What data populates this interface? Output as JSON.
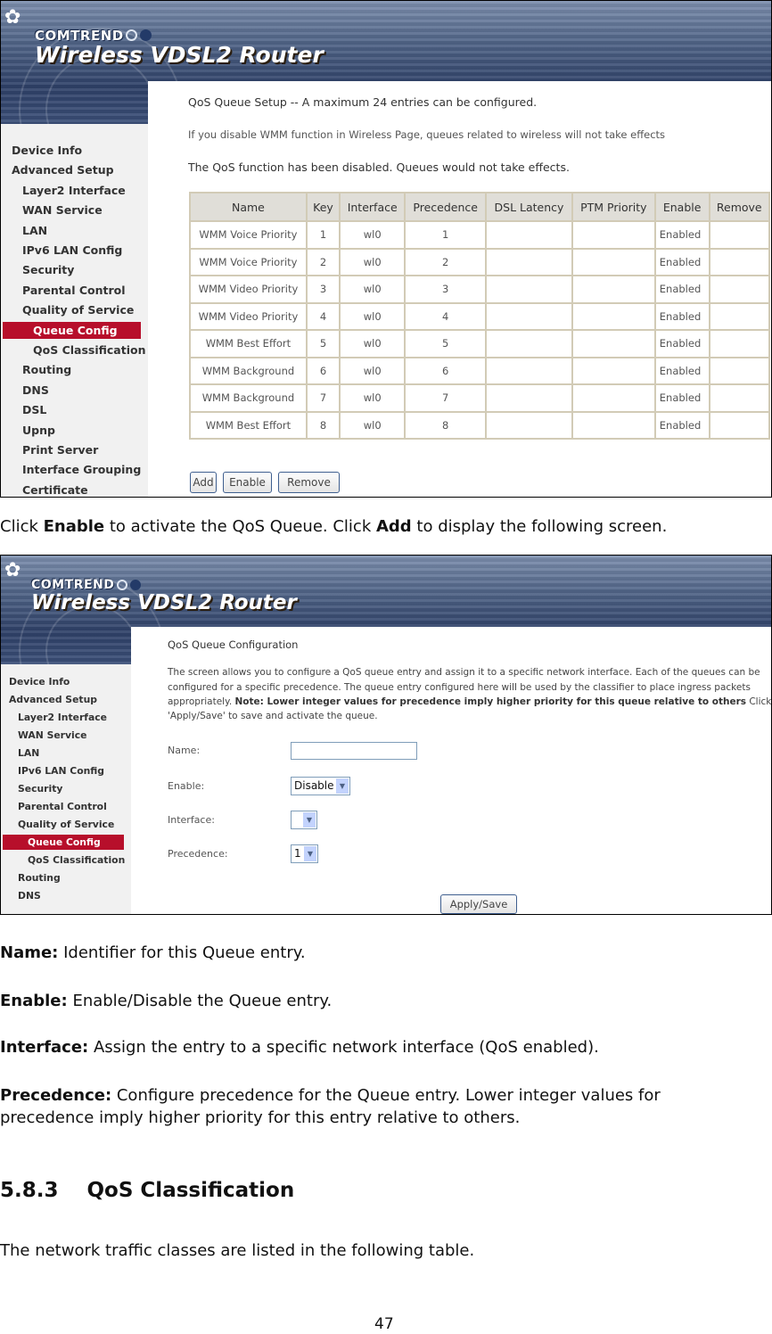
{
  "brand": {
    "company": "COMTREND",
    "product": "Wireless VDSL2 Router"
  },
  "screenshot1": {
    "sidebar": [
      {
        "label": "Device Info",
        "level": 0,
        "active": false
      },
      {
        "label": "Advanced Setup",
        "level": 0,
        "active": false
      },
      {
        "label": "Layer2 Interface",
        "level": 1,
        "active": false
      },
      {
        "label": "WAN Service",
        "level": 1,
        "active": false
      },
      {
        "label": "LAN",
        "level": 1,
        "active": false
      },
      {
        "label": "IPv6 LAN Config",
        "level": 1,
        "active": false
      },
      {
        "label": "Security",
        "level": 1,
        "active": false
      },
      {
        "label": "Parental Control",
        "level": 1,
        "active": false
      },
      {
        "label": "Quality of Service",
        "level": 1,
        "active": false
      },
      {
        "label": "Queue Config",
        "level": 2,
        "active": true
      },
      {
        "label": "QoS Classification",
        "level": 2,
        "active": false
      },
      {
        "label": "Routing",
        "level": 1,
        "active": false
      },
      {
        "label": "DNS",
        "level": 1,
        "active": false
      },
      {
        "label": "DSL",
        "level": 1,
        "active": false
      },
      {
        "label": "Upnp",
        "level": 1,
        "active": false
      },
      {
        "label": "Print Server",
        "level": 1,
        "active": false
      },
      {
        "label": "Interface Grouping",
        "level": 1,
        "active": false
      },
      {
        "label": "Certificate",
        "level": 1,
        "active": false
      }
    ],
    "title": "QoS Queue Setup -- A maximum 24 entries can be configured.",
    "wmm_note": "If you disable WMM function in Wireless Page, queues related to wireless will not take effects",
    "disabled_note": "The QoS function has been disabled. Queues would not take effects.",
    "table": {
      "headers": [
        "Name",
        "Key",
        "Interface",
        "Precedence",
        "DSL Latency",
        "PTM Priority",
        "Enable",
        "Remove"
      ],
      "rows": [
        [
          "WMM Voice Priority",
          "1",
          "wl0",
          "1",
          "",
          "",
          "Enabled",
          ""
        ],
        [
          "WMM Voice Priority",
          "2",
          "wl0",
          "2",
          "",
          "",
          "Enabled",
          ""
        ],
        [
          "WMM Video Priority",
          "3",
          "wl0",
          "3",
          "",
          "",
          "Enabled",
          ""
        ],
        [
          "WMM Video Priority",
          "4",
          "wl0",
          "4",
          "",
          "",
          "Enabled",
          ""
        ],
        [
          "WMM Best Effort",
          "5",
          "wl0",
          "5",
          "",
          "",
          "Enabled",
          ""
        ],
        [
          "WMM Background",
          "6",
          "wl0",
          "6",
          "",
          "",
          "Enabled",
          ""
        ],
        [
          "WMM Background",
          "7",
          "wl0",
          "7",
          "",
          "",
          "Enabled",
          ""
        ],
        [
          "WMM Best Effort",
          "8",
          "wl0",
          "8",
          "",
          "",
          "Enabled",
          ""
        ]
      ]
    },
    "buttons": {
      "add": "Add",
      "enable": "Enable",
      "remove": "Remove"
    }
  },
  "caption1": {
    "pre": "Click ",
    "b1": "Enable",
    "mid": " to activate the QoS Queue. Click ",
    "b2": "Add",
    "post": " to display the following screen."
  },
  "screenshot2": {
    "sidebar": [
      {
        "label": "Device Info",
        "level": 0,
        "active": false
      },
      {
        "label": "Advanced Setup",
        "level": 0,
        "active": false
      },
      {
        "label": "Layer2 Interface",
        "level": 1,
        "active": false
      },
      {
        "label": "WAN Service",
        "level": 1,
        "active": false
      },
      {
        "label": "LAN",
        "level": 1,
        "active": false
      },
      {
        "label": "IPv6 LAN Config",
        "level": 1,
        "active": false
      },
      {
        "label": "Security",
        "level": 1,
        "active": false
      },
      {
        "label": "Parental Control",
        "level": 1,
        "active": false
      },
      {
        "label": "Quality of Service",
        "level": 1,
        "active": false
      },
      {
        "label": "Queue Config",
        "level": 2,
        "active": true
      },
      {
        "label": "QoS Classification",
        "level": 2,
        "active": false
      },
      {
        "label": "Routing",
        "level": 1,
        "active": false
      },
      {
        "label": "DNS",
        "level": 1,
        "active": false
      }
    ],
    "title": "QoS Queue Configuration",
    "desc_line1": "The screen allows you to configure a QoS queue entry and assign it to a specific network interface. Each of the queues can be",
    "desc_line2": "configured for a specific precedence. The queue entry configured here will be used by the classifier to place ingress packets",
    "desc_line3_pre": "appropriately. ",
    "desc_line3_bold": "Note: Lower integer values for precedence imply higher priority for this queue relative to others",
    "desc_line3_post": " Click",
    "desc_line4": "'Apply/Save' to save and activate the queue.",
    "form": {
      "name_label": "Name:",
      "name_value": "",
      "enable_label": "Enable:",
      "enable_value": "Disable",
      "interface_label": "Interface:",
      "interface_value": "",
      "precedence_label": "Precedence:",
      "precedence_value": "1"
    },
    "apply_button": "Apply/Save"
  },
  "descriptions": [
    {
      "term": "Name:",
      "text": " Identifier for this Queue entry."
    },
    {
      "term": "Enable:",
      "text": " Enable/Disable the Queue entry."
    },
    {
      "term": "Interface:",
      "text": " Assign the entry to a specific network interface (QoS enabled)."
    },
    {
      "term": "Precedence:",
      "text": " Configure precedence for the Queue entry. Lower integer values for",
      "text2": "precedence imply higher priority for this entry relative to others."
    }
  ],
  "section": {
    "number": "5.8.3",
    "title": "QoS Classification",
    "intro": "The network traffic classes are listed in the following table."
  },
  "page_number": "47"
}
